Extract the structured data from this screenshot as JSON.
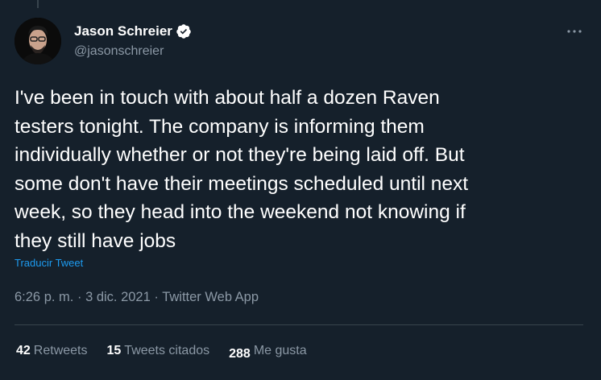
{
  "author": {
    "display_name": "Jason Schreier",
    "handle": "@jasonschreier",
    "verified": true
  },
  "tweet": {
    "text": "I've been in touch with about half a dozen Raven\ntesters tonight. The company is informing them\nindividually whether or not they're being laid off. But\nsome don't have their meetings scheduled until next\nweek, so they head into the weekend not knowing if\nthey still have jobs",
    "translate_label": "Traducir Tweet",
    "time": "6:26 p. m.",
    "date": "3 dic. 2021",
    "source": "Twitter Web App",
    "separator": "·"
  },
  "stats": {
    "retweets": {
      "count": "42",
      "label": "Retweets"
    },
    "quotes": {
      "count": "15",
      "label": "Tweets citados"
    },
    "likes": {
      "count": "288",
      "label": "Me gusta"
    }
  },
  "icons": {
    "more": "more-icon",
    "verified": "verified-badge-icon"
  },
  "colors": {
    "background": "#15202b",
    "accent": "#1d9bf0",
    "secondary_text": "#8b98a5",
    "divider": "#38444d"
  }
}
